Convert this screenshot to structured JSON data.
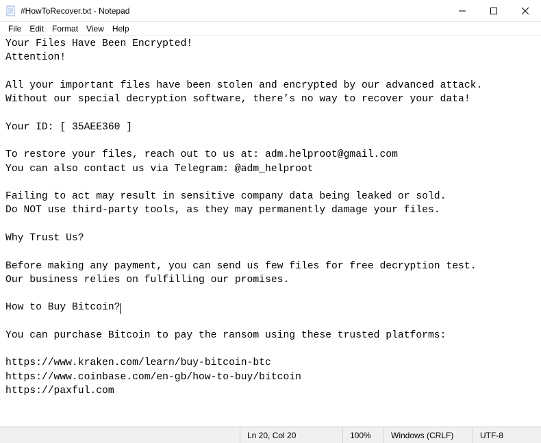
{
  "window": {
    "title": "#HowToRecover.txt - Notepad"
  },
  "menu": {
    "file": "File",
    "edit": "Edit",
    "format": "Format",
    "view": "View",
    "help": "Help"
  },
  "content": {
    "text_before_cursor": "Your Files Have Been Encrypted!\nAttention!\n\nAll your important files have been stolen and encrypted by our advanced attack.\nWithout our special decryption software, there’s no way to recover your data!\n\nYour ID: [ 35AEE360 ]\n\nTo restore your files, reach out to us at: adm.helproot@gmail.com\nYou can also contact us via Telegram: @adm_helproot\n\nFailing to act may result in sensitive company data being leaked or sold.\nDo NOT use third-party tools, as they may permanently damage your files.\n\nWhy Trust Us?\n\nBefore making any payment, you can send us few files for free decryption test.\nOur business relies on fulfilling our promises.\n\nHow to Buy Bitcoin?",
    "text_after_cursor": "\n\nYou can purchase Bitcoin to pay the ransom using these trusted platforms:\n\nhttps://www.kraken.com/learn/buy-bitcoin-btc\nhttps://www.coinbase.com/en-gb/how-to-buy/bitcoin\nhttps://paxful.com"
  },
  "statusbar": {
    "position": "Ln 20, Col 20",
    "zoom": "100%",
    "line_ending": "Windows (CRLF)",
    "encoding": "UTF-8"
  }
}
